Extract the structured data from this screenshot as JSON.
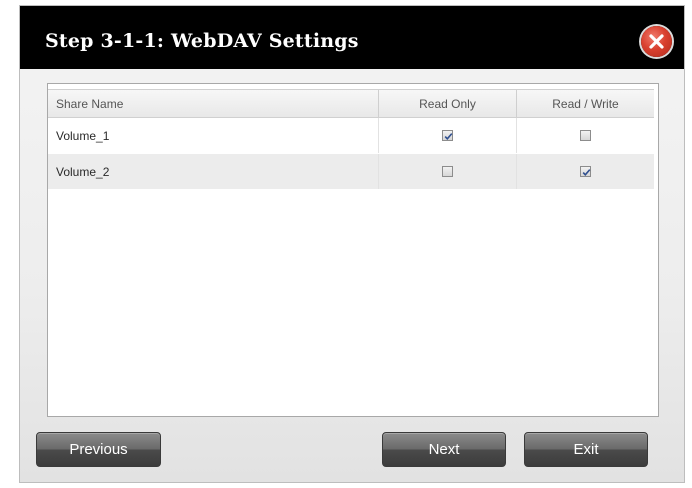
{
  "dialog": {
    "title": "Step 3-1-1: WebDAV Settings"
  },
  "table": {
    "columns": [
      "Share Name",
      "Read Only",
      "Read / Write"
    ],
    "rows": [
      {
        "share_name": "Volume_1",
        "read_only": true,
        "read_write": false
      },
      {
        "share_name": "Volume_2",
        "read_only": false,
        "read_write": true
      }
    ]
  },
  "buttons": {
    "previous": "Previous",
    "next": "Next",
    "exit": "Exit"
  },
  "icons": {
    "close": "close-icon",
    "checkbox": "checkbox"
  },
  "colors": {
    "titlebar": "#000000",
    "close": "#d9402f",
    "button": "#5a5a5a"
  }
}
